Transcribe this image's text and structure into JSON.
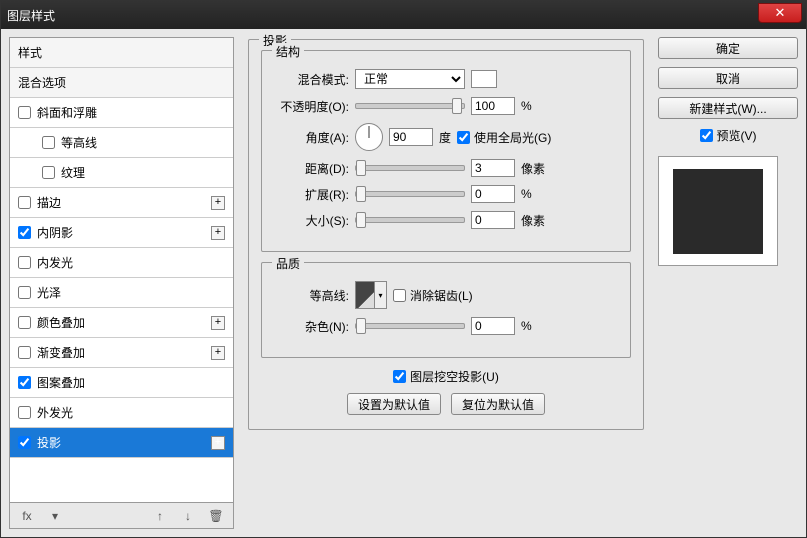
{
  "window": {
    "title": "图层样式"
  },
  "buttons": {
    "ok": "确定",
    "cancel": "取消",
    "new_style": "新建样式(W)...",
    "preview": "预览(V)",
    "set_default": "设置为默认值",
    "reset_default": "复位为默认值"
  },
  "sidebar": {
    "header_styles": "样式",
    "header_blend": "混合选项",
    "items": [
      {
        "label": "斜面和浮雕",
        "checked": false,
        "plus": false
      },
      {
        "label": "等高线",
        "checked": false,
        "indent": true
      },
      {
        "label": "纹理",
        "checked": false,
        "indent": true
      },
      {
        "label": "描边",
        "checked": false,
        "plus": true
      },
      {
        "label": "内阴影",
        "checked": true,
        "plus": true
      },
      {
        "label": "内发光",
        "checked": false
      },
      {
        "label": "光泽",
        "checked": false
      },
      {
        "label": "颜色叠加",
        "checked": false,
        "plus": true
      },
      {
        "label": "渐变叠加",
        "checked": false,
        "plus": true
      },
      {
        "label": "图案叠加",
        "checked": true
      },
      {
        "label": "外发光",
        "checked": false
      },
      {
        "label": "投影",
        "checked": true,
        "plus": true,
        "selected": true
      }
    ]
  },
  "panel": {
    "title": "投影",
    "structure": {
      "legend": "结构",
      "blend_mode_label": "混合模式:",
      "blend_mode_value": "正常",
      "opacity_label": "不透明度(O):",
      "opacity_value": "100",
      "percent": "%",
      "angle_label": "角度(A):",
      "angle_value": "90",
      "degree": "度",
      "use_global": "使用全局光(G)",
      "distance_label": "距离(D):",
      "distance_value": "3",
      "pixel": "像素",
      "spread_label": "扩展(R):",
      "spread_value": "0",
      "size_label": "大小(S):",
      "size_value": "0"
    },
    "quality": {
      "legend": "品质",
      "contour_label": "等高线:",
      "antialias": "消除锯齿(L)",
      "noise_label": "杂色(N):",
      "noise_value": "0"
    },
    "knockout": "图层挖空投影(U)"
  },
  "footer_icons": {
    "fx": "fx",
    "down": "▾",
    "up": "↑",
    "down2": "↓",
    "trash": "🗑"
  }
}
